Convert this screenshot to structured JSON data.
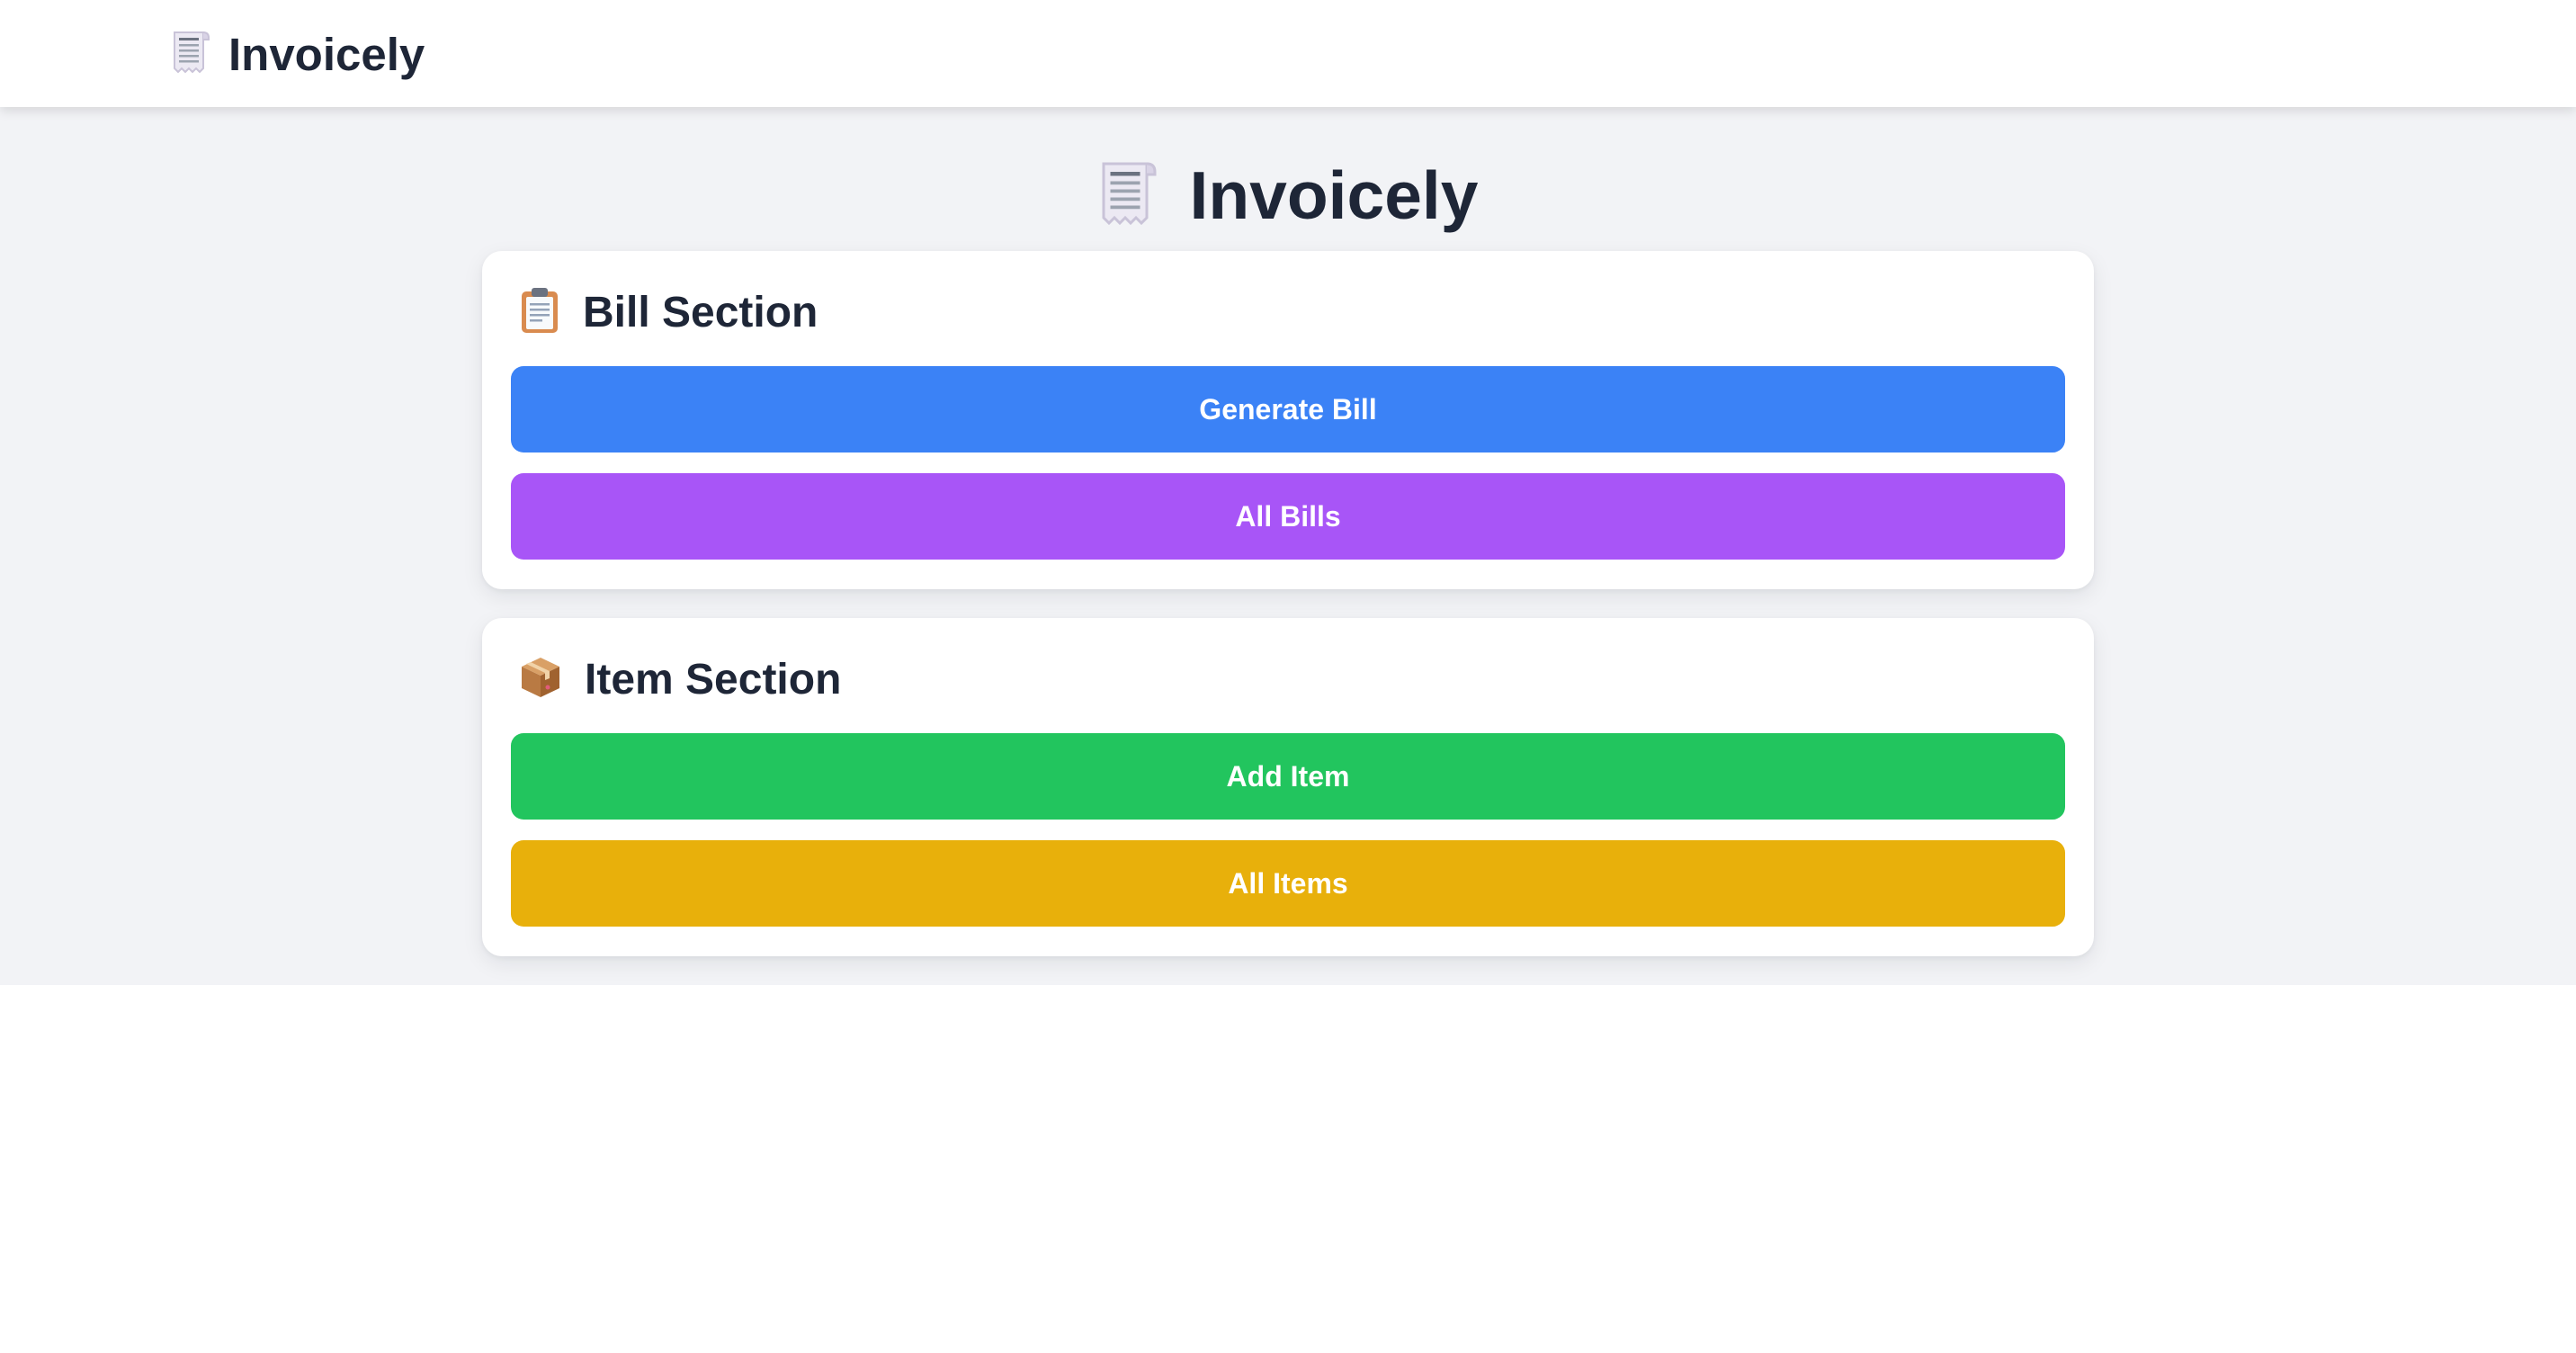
{
  "navbar": {
    "brand_title": "Invoicely",
    "brand_icon": "receipt-icon"
  },
  "main": {
    "heading": "Invoicely",
    "heading_icon": "receipt-icon"
  },
  "bill_section": {
    "title": "Bill Section",
    "icon": "clipboard-icon",
    "buttons": [
      {
        "label": "Generate Bill",
        "color": "#3b82f6"
      },
      {
        "label": "All Bills",
        "color": "#a855f7"
      }
    ]
  },
  "item_section": {
    "title": "Item Section",
    "icon": "package-icon",
    "buttons": [
      {
        "label": "Add Item",
        "color": "#22c55e"
      },
      {
        "label": "All Items",
        "color": "#e8b00b"
      }
    ]
  },
  "colors": {
    "background": "#f2f3f6",
    "text_dark": "#1e2637"
  }
}
